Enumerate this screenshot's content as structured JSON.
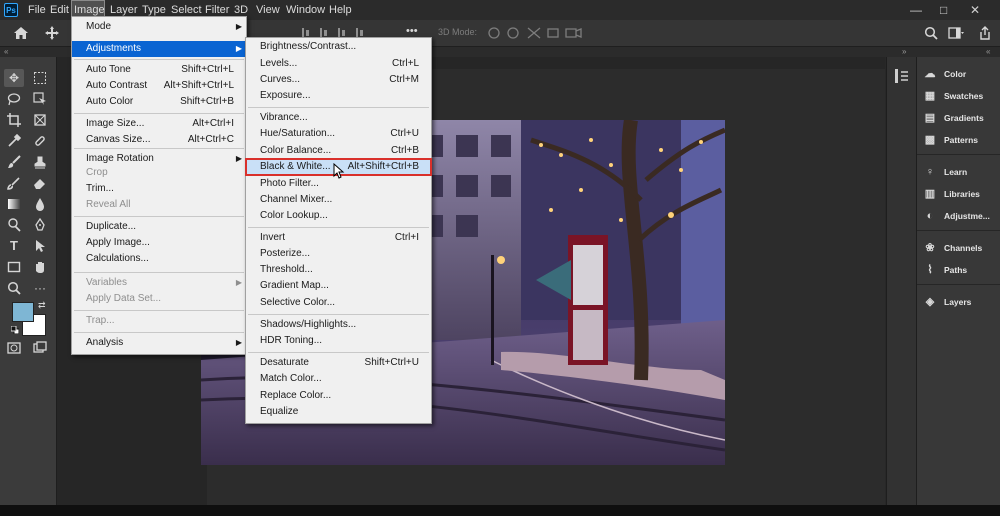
{
  "menubar": {
    "logo": "Ps",
    "items": [
      "File",
      "Edit",
      "Image",
      "Layer",
      "Type",
      "Select",
      "Filter",
      "3D",
      "View",
      "Window",
      "Help"
    ],
    "window_controls": [
      "—",
      "□",
      "✕"
    ]
  },
  "optionsbar": {
    "mode_3d_label": "3D Mode:",
    "more_label": "•••"
  },
  "image_menu": {
    "items": [
      {
        "label": "Mode",
        "shortcut": "",
        "submenu": true,
        "disabled": false
      },
      {
        "label": "Adjustments",
        "shortcut": "",
        "submenu": true,
        "disabled": false,
        "highlighted": true
      },
      {
        "label": "Auto Tone",
        "shortcut": "Shift+Ctrl+L",
        "disabled": false
      },
      {
        "label": "Auto Contrast",
        "shortcut": "Alt+Shift+Ctrl+L",
        "disabled": false
      },
      {
        "label": "Auto Color",
        "shortcut": "Shift+Ctrl+B",
        "disabled": false
      },
      {
        "label": "Image Size...",
        "shortcut": "Alt+Ctrl+I",
        "disabled": false
      },
      {
        "label": "Canvas Size...",
        "shortcut": "Alt+Ctrl+C",
        "disabled": false
      },
      {
        "label": "Image Rotation",
        "shortcut": "",
        "submenu": true,
        "disabled": false
      },
      {
        "label": "Crop",
        "shortcut": "",
        "disabled": true
      },
      {
        "label": "Trim...",
        "shortcut": "",
        "disabled": false
      },
      {
        "label": "Reveal All",
        "shortcut": "",
        "disabled": true
      },
      {
        "label": "Duplicate...",
        "shortcut": "",
        "disabled": false
      },
      {
        "label": "Apply Image...",
        "shortcut": "",
        "disabled": false
      },
      {
        "label": "Calculations...",
        "shortcut": "",
        "disabled": false
      },
      {
        "label": "Variables",
        "shortcut": "",
        "submenu": true,
        "disabled": true
      },
      {
        "label": "Apply Data Set...",
        "shortcut": "",
        "disabled": true
      },
      {
        "label": "Trap...",
        "shortcut": "",
        "disabled": true
      },
      {
        "label": "Analysis",
        "shortcut": "",
        "submenu": true,
        "disabled": false
      }
    ]
  },
  "adjustments_menu": {
    "items": [
      {
        "label": "Brightness/Contrast...",
        "shortcut": ""
      },
      {
        "label": "Levels...",
        "shortcut": "Ctrl+L"
      },
      {
        "label": "Curves...",
        "shortcut": "Ctrl+M"
      },
      {
        "label": "Exposure...",
        "shortcut": ""
      },
      {
        "label": "Vibrance...",
        "shortcut": ""
      },
      {
        "label": "Hue/Saturation...",
        "shortcut": "Ctrl+U"
      },
      {
        "label": "Color Balance...",
        "shortcut": "Ctrl+B"
      },
      {
        "label": "Black & White...",
        "shortcut": "Alt+Shift+Ctrl+B",
        "highlighted": true
      },
      {
        "label": "Photo Filter...",
        "shortcut": ""
      },
      {
        "label": "Channel Mixer...",
        "shortcut": ""
      },
      {
        "label": "Color Lookup...",
        "shortcut": ""
      },
      {
        "label": "Invert",
        "shortcut": "Ctrl+I"
      },
      {
        "label": "Posterize...",
        "shortcut": ""
      },
      {
        "label": "Threshold...",
        "shortcut": ""
      },
      {
        "label": "Gradient Map...",
        "shortcut": ""
      },
      {
        "label": "Selective Color...",
        "shortcut": ""
      },
      {
        "label": "Shadows/Highlights...",
        "shortcut": ""
      },
      {
        "label": "HDR Toning...",
        "shortcut": ""
      },
      {
        "label": "Desaturate",
        "shortcut": "Shift+Ctrl+U"
      },
      {
        "label": "Match Color...",
        "shortcut": ""
      },
      {
        "label": "Replace Color...",
        "shortcut": ""
      },
      {
        "label": "Equalize",
        "shortcut": ""
      }
    ]
  },
  "right_panels": {
    "items": [
      {
        "label": "Color",
        "icon": "color-wheel-icon"
      },
      {
        "label": "Swatches",
        "icon": "swatches-grid-icon"
      },
      {
        "label": "Gradients",
        "icon": "gradient-icon"
      },
      {
        "label": "Patterns",
        "icon": "patterns-icon"
      },
      {
        "label": "Learn",
        "icon": "lightbulb-icon"
      },
      {
        "label": "Libraries",
        "icon": "libraries-icon"
      },
      {
        "label": "Adjustme...",
        "icon": "adjustments-icon"
      },
      {
        "label": "Channels",
        "icon": "channels-icon"
      },
      {
        "label": "Paths",
        "icon": "paths-icon"
      },
      {
        "label": "Layers",
        "icon": "layers-icon"
      }
    ]
  },
  "colors": {
    "foreground": "#7eb6d4",
    "background": "#ffffff",
    "menu_highlight": "#0a64d2",
    "highlight_border": "#d9302b"
  }
}
